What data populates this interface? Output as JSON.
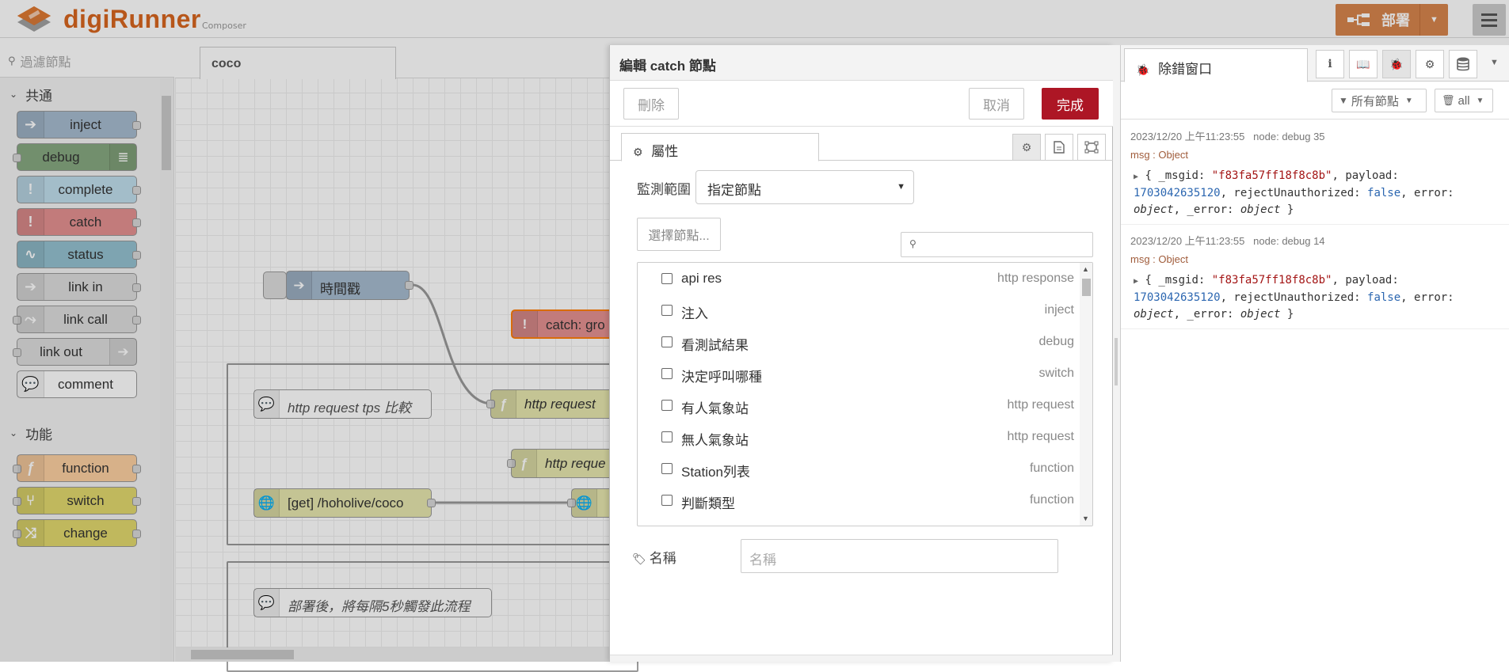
{
  "app": {
    "brand": "digiRunner",
    "brand_sub": "Composer",
    "deploy_label": "部署"
  },
  "palette": {
    "search_placeholder": "過濾節點",
    "categories": [
      {
        "label": "共通",
        "nodes": [
          {
            "label": "inject",
            "color": "#a6bbcf"
          },
          {
            "label": "debug",
            "color": "#87a980"
          },
          {
            "label": "complete",
            "color": "#c0deed"
          },
          {
            "label": "catch",
            "color": "#e49191"
          },
          {
            "label": "status",
            "color": "#94c1d0"
          },
          {
            "label": "link in",
            "color": "#dddddd"
          },
          {
            "label": "link call",
            "color": "#dddddd"
          },
          {
            "label": "link out",
            "color": "#dddddd"
          },
          {
            "label": "comment",
            "color": "#ffffff"
          }
        ]
      },
      {
        "label": "功能",
        "nodes": [
          {
            "label": "function",
            "color": "#fdd0a2"
          },
          {
            "label": "switch",
            "color": "#e2d96e"
          },
          {
            "label": "change",
            "color": "#e2d96e"
          }
        ]
      }
    ]
  },
  "workspace": {
    "tab_label": "coco",
    "nodes": {
      "timestamp": "時間戳",
      "catch": "catch: gro",
      "comment_tps": "http request tps 比較",
      "http_req_1": "http request",
      "http_req_2": "http reque",
      "get_endpoint": "[get] /hoholive/coco",
      "comment_deploy": "部署後，將每隔5秒觸發此流程"
    }
  },
  "editor": {
    "title": "編輯 catch 節點",
    "delete_label": "刪除",
    "cancel_label": "取消",
    "done_label": "完成",
    "tab_properties": "屬性",
    "scope_label": "監測範圍",
    "scope_value": "指定節點",
    "select_nodes_label": "選擇節點...",
    "name_label": "名稱",
    "name_placeholder": "名稱",
    "node_list": [
      {
        "name": "api res",
        "type": "http response"
      },
      {
        "name": "注入",
        "type": "inject"
      },
      {
        "name": "看測試結果",
        "type": "debug"
      },
      {
        "name": "決定呼叫哪種",
        "type": "switch"
      },
      {
        "name": "有人氣象站",
        "type": "http request"
      },
      {
        "name": "無人氣象站",
        "type": "http request"
      },
      {
        "name": "Station列表",
        "type": "function"
      },
      {
        "name": "判斷類型",
        "type": "function"
      }
    ]
  },
  "sidebar": {
    "tab_label": "除錯窗口",
    "filter_nodes": "所有節點",
    "filter_all": "all",
    "messages": [
      {
        "timestamp": "2023/12/20 上午11:23:55",
        "node": "node: debug 35",
        "topic": "msg : Object",
        "msgid": "\"f83fa57ff18f8c8b\"",
        "payload": "1703042635120",
        "reject": "false"
      },
      {
        "timestamp": "2023/12/20 上午11:23:55",
        "node": "node: debug 14",
        "topic": "msg : Object",
        "msgid": "\"f83fa57ff18f8c8b\"",
        "payload": "1703042635120",
        "reject": "false"
      }
    ]
  }
}
